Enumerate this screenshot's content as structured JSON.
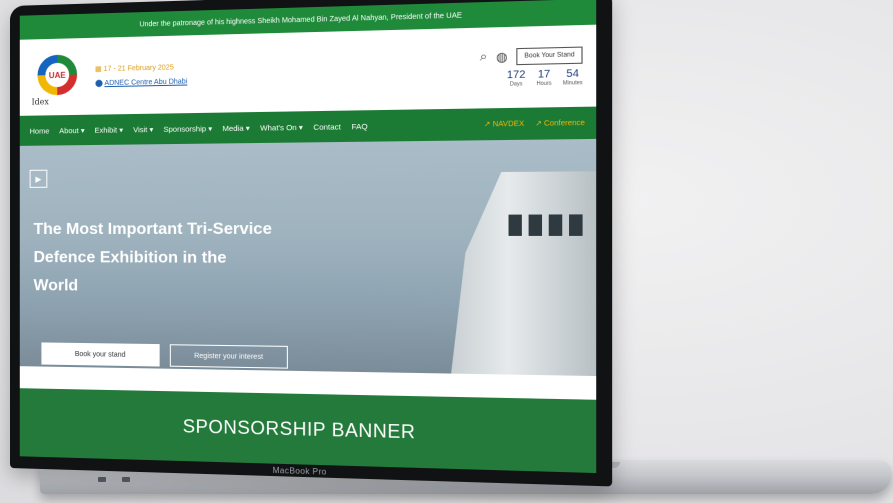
{
  "topbar": {
    "text": "Under the patronage of his highness Sheikh Mohamed Bin Zayed Al Nahyan, President of the UAE"
  },
  "header": {
    "logo_text": "UAE",
    "logo_subtext": "Idex",
    "date": "17 - 21 February 2025",
    "venue": "ADNEC Centre Abu Dhabi",
    "book_button": "Book Your Stand",
    "countdown": [
      {
        "value": "172",
        "label": "Days"
      },
      {
        "value": "17",
        "label": "Hours"
      },
      {
        "value": "54",
        "label": "Minutes"
      }
    ]
  },
  "nav": {
    "items": [
      {
        "label": "Home"
      },
      {
        "label": "About ▾"
      },
      {
        "label": "Exhibit ▾"
      },
      {
        "label": "Visit ▾"
      },
      {
        "label": "Sponsorship ▾"
      },
      {
        "label": "Media ▾"
      },
      {
        "label": "What's On ▾"
      },
      {
        "label": "Contact"
      },
      {
        "label": "FAQ"
      }
    ],
    "right": [
      {
        "label": "↗ NAVDEX"
      },
      {
        "label": "↗ Conference"
      }
    ]
  },
  "hero": {
    "title_line1": "The Most Important Tri-Service",
    "title_line2": "Defence Exhibition in the",
    "title_line3": "World",
    "primary_button": "Book your stand",
    "secondary_button": "Register your interest"
  },
  "sponsor_banner": "SPONSORSHIP BANNER",
  "device_label": "MacBook Pro",
  "icons": {
    "search": "search-icon",
    "globe": "globe-icon",
    "calendar": "calendar-icon",
    "location": "location-pin-icon",
    "play": "play-icon"
  },
  "colors": {
    "brand_green": "#1f8a3a",
    "nav_green": "#1b7a34",
    "accent_gold": "#e09b12"
  }
}
